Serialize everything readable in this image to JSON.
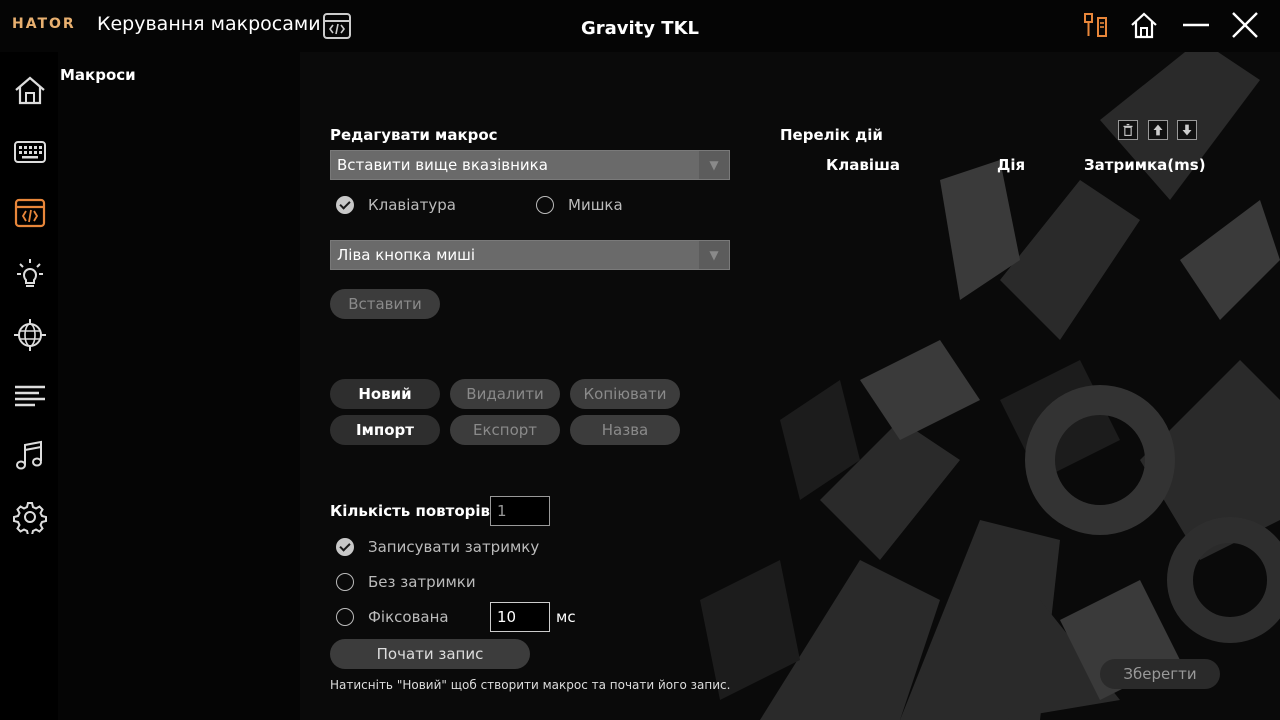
{
  "window": {
    "brand": "HATOR",
    "title": "Керування макросами",
    "device": "Gravity TKL"
  },
  "titlebar_icons": [
    "title-macro-icon",
    "usb-cable-icon",
    "home-icon",
    "minimize-icon",
    "close-icon"
  ],
  "sidebar": {
    "items": [
      {
        "name": "home-icon"
      },
      {
        "name": "keyboard-icon"
      },
      {
        "name": "macro-icon",
        "active": true
      },
      {
        "name": "lighting-icon"
      },
      {
        "name": "globe-icon"
      },
      {
        "name": "equalizer-icon"
      },
      {
        "name": "music-icon"
      },
      {
        "name": "settings-icon"
      }
    ],
    "submenu_title": "Макроси"
  },
  "editor": {
    "heading": "Редагувати макрос",
    "insert_mode": "Вставити вище вказівника",
    "source_options": [
      {
        "label": "Клавіатура",
        "checked": true
      },
      {
        "label": "Мишка",
        "checked": false
      }
    ],
    "mouse_button": "Ліва кнопка миші",
    "insert_button": "Вставити"
  },
  "macro_buttons": {
    "new": "Новий",
    "delete": "Видалити",
    "copy": "Копіювати",
    "import": "Імпорт",
    "export": "Експорт",
    "rename": "Назва"
  },
  "repeat": {
    "label": "Кількість повторів",
    "value": "1"
  },
  "delay_options": [
    {
      "label": "Записувати затримку",
      "checked": true
    },
    {
      "label": "Без затримки",
      "checked": false
    },
    {
      "label": "Фіксована",
      "checked": false
    }
  ],
  "fixed_delay": {
    "value": "10",
    "unit": "мс"
  },
  "record_button": "Почати запис",
  "hint": "Натисніть \"Новий\" щоб створити макрос та почати його запис.",
  "action_list": {
    "heading": "Перелік дій",
    "columns": [
      "Клавіша",
      "Дія",
      "Затримка(ms)"
    ],
    "toolbar": [
      "trash-icon",
      "move-up-icon",
      "move-down-icon"
    ]
  },
  "save_button": "Зберегти",
  "colors": {
    "accent": "#e8863a",
    "brand": "#e8b070",
    "select_bg": "#6a6a6a"
  }
}
